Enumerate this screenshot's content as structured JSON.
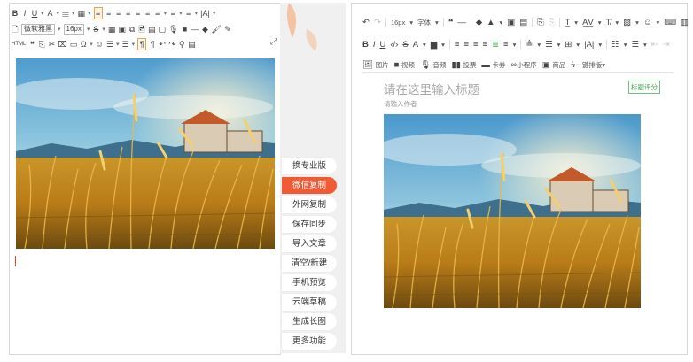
{
  "left_editor": {
    "font_family_select": "微软雅黑",
    "font_size_select": "16px",
    "toolbar_row1": [
      "B",
      "I",
      "U",
      "A",
      "𝄙",
      "▦",
      "≡",
      "≡",
      "≡",
      "≡",
      "≡",
      "≡",
      "≡",
      "≡",
      "≡",
      "|A|"
    ],
    "toolbar_row3": [
      "HTML",
      "❝",
      "⎘",
      "✂",
      "⌧",
      "▭",
      "Ω",
      "☺",
      "☰",
      "☰",
      "¶",
      "¶",
      "↶",
      "↷",
      "⚲",
      "▤"
    ]
  },
  "side_menu": {
    "items": [
      "换专业版",
      "微信复制",
      "外网复制",
      "保存同步",
      "导入文章",
      "清空/新建",
      "手机预览",
      "云端草稿",
      "生成长图",
      "更多功能"
    ],
    "active_index": 1
  },
  "right_editor": {
    "font_size_select": "16px",
    "font_family_select": "字体",
    "media_tools": [
      {
        "icon": "image-icon",
        "label": "图片"
      },
      {
        "icon": "video-icon",
        "label": "视频"
      },
      {
        "icon": "mic-icon",
        "label": "音频"
      },
      {
        "icon": "vote-icon",
        "label": "投票"
      },
      {
        "icon": "card-icon",
        "label": "卡券"
      },
      {
        "icon": "miniprogram-icon",
        "label": "小程序"
      },
      {
        "icon": "shop-icon",
        "label": "商品"
      },
      {
        "icon": "layout-icon",
        "label": "一键排版"
      }
    ],
    "title_placeholder": "请在这里输入标题",
    "author_placeholder": "请输入作者",
    "score_button": "标题评分"
  },
  "colors": {
    "accent_orange": "#f05a34",
    "green": "#3da84f",
    "border": "#d7d7d7"
  }
}
